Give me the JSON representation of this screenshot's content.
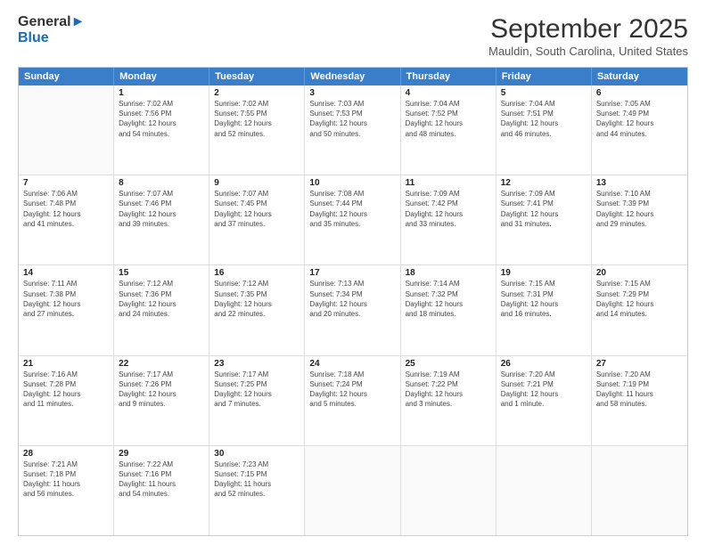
{
  "logo": {
    "line1": "General",
    "line2": "Blue"
  },
  "title": "September 2025",
  "location": "Mauldin, South Carolina, United States",
  "days_of_week": [
    "Sunday",
    "Monday",
    "Tuesday",
    "Wednesday",
    "Thursday",
    "Friday",
    "Saturday"
  ],
  "weeks": [
    [
      {
        "day": null,
        "info": null
      },
      {
        "day": "1",
        "info": "Sunrise: 7:02 AM\nSunset: 7:56 PM\nDaylight: 12 hours\nand 54 minutes."
      },
      {
        "day": "2",
        "info": "Sunrise: 7:02 AM\nSunset: 7:55 PM\nDaylight: 12 hours\nand 52 minutes."
      },
      {
        "day": "3",
        "info": "Sunrise: 7:03 AM\nSunset: 7:53 PM\nDaylight: 12 hours\nand 50 minutes."
      },
      {
        "day": "4",
        "info": "Sunrise: 7:04 AM\nSunset: 7:52 PM\nDaylight: 12 hours\nand 48 minutes."
      },
      {
        "day": "5",
        "info": "Sunrise: 7:04 AM\nSunset: 7:51 PM\nDaylight: 12 hours\nand 46 minutes."
      },
      {
        "day": "6",
        "info": "Sunrise: 7:05 AM\nSunset: 7:49 PM\nDaylight: 12 hours\nand 44 minutes."
      }
    ],
    [
      {
        "day": "7",
        "info": "Sunrise: 7:06 AM\nSunset: 7:48 PM\nDaylight: 12 hours\nand 41 minutes."
      },
      {
        "day": "8",
        "info": "Sunrise: 7:07 AM\nSunset: 7:46 PM\nDaylight: 12 hours\nand 39 minutes."
      },
      {
        "day": "9",
        "info": "Sunrise: 7:07 AM\nSunset: 7:45 PM\nDaylight: 12 hours\nand 37 minutes."
      },
      {
        "day": "10",
        "info": "Sunrise: 7:08 AM\nSunset: 7:44 PM\nDaylight: 12 hours\nand 35 minutes."
      },
      {
        "day": "11",
        "info": "Sunrise: 7:09 AM\nSunset: 7:42 PM\nDaylight: 12 hours\nand 33 minutes."
      },
      {
        "day": "12",
        "info": "Sunrise: 7:09 AM\nSunset: 7:41 PM\nDaylight: 12 hours\nand 31 minutes."
      },
      {
        "day": "13",
        "info": "Sunrise: 7:10 AM\nSunset: 7:39 PM\nDaylight: 12 hours\nand 29 minutes."
      }
    ],
    [
      {
        "day": "14",
        "info": "Sunrise: 7:11 AM\nSunset: 7:38 PM\nDaylight: 12 hours\nand 27 minutes."
      },
      {
        "day": "15",
        "info": "Sunrise: 7:12 AM\nSunset: 7:36 PM\nDaylight: 12 hours\nand 24 minutes."
      },
      {
        "day": "16",
        "info": "Sunrise: 7:12 AM\nSunset: 7:35 PM\nDaylight: 12 hours\nand 22 minutes."
      },
      {
        "day": "17",
        "info": "Sunrise: 7:13 AM\nSunset: 7:34 PM\nDaylight: 12 hours\nand 20 minutes."
      },
      {
        "day": "18",
        "info": "Sunrise: 7:14 AM\nSunset: 7:32 PM\nDaylight: 12 hours\nand 18 minutes."
      },
      {
        "day": "19",
        "info": "Sunrise: 7:15 AM\nSunset: 7:31 PM\nDaylight: 12 hours\nand 16 minutes."
      },
      {
        "day": "20",
        "info": "Sunrise: 7:15 AM\nSunset: 7:29 PM\nDaylight: 12 hours\nand 14 minutes."
      }
    ],
    [
      {
        "day": "21",
        "info": "Sunrise: 7:16 AM\nSunset: 7:28 PM\nDaylight: 12 hours\nand 11 minutes."
      },
      {
        "day": "22",
        "info": "Sunrise: 7:17 AM\nSunset: 7:26 PM\nDaylight: 12 hours\nand 9 minutes."
      },
      {
        "day": "23",
        "info": "Sunrise: 7:17 AM\nSunset: 7:25 PM\nDaylight: 12 hours\nand 7 minutes."
      },
      {
        "day": "24",
        "info": "Sunrise: 7:18 AM\nSunset: 7:24 PM\nDaylight: 12 hours\nand 5 minutes."
      },
      {
        "day": "25",
        "info": "Sunrise: 7:19 AM\nSunset: 7:22 PM\nDaylight: 12 hours\nand 3 minutes."
      },
      {
        "day": "26",
        "info": "Sunrise: 7:20 AM\nSunset: 7:21 PM\nDaylight: 12 hours\nand 1 minute."
      },
      {
        "day": "27",
        "info": "Sunrise: 7:20 AM\nSunset: 7:19 PM\nDaylight: 11 hours\nand 58 minutes."
      }
    ],
    [
      {
        "day": "28",
        "info": "Sunrise: 7:21 AM\nSunset: 7:18 PM\nDaylight: 11 hours\nand 56 minutes."
      },
      {
        "day": "29",
        "info": "Sunrise: 7:22 AM\nSunset: 7:16 PM\nDaylight: 11 hours\nand 54 minutes."
      },
      {
        "day": "30",
        "info": "Sunrise: 7:23 AM\nSunset: 7:15 PM\nDaylight: 11 hours\nand 52 minutes."
      },
      {
        "day": null,
        "info": null
      },
      {
        "day": null,
        "info": null
      },
      {
        "day": null,
        "info": null
      },
      {
        "day": null,
        "info": null
      }
    ]
  ]
}
